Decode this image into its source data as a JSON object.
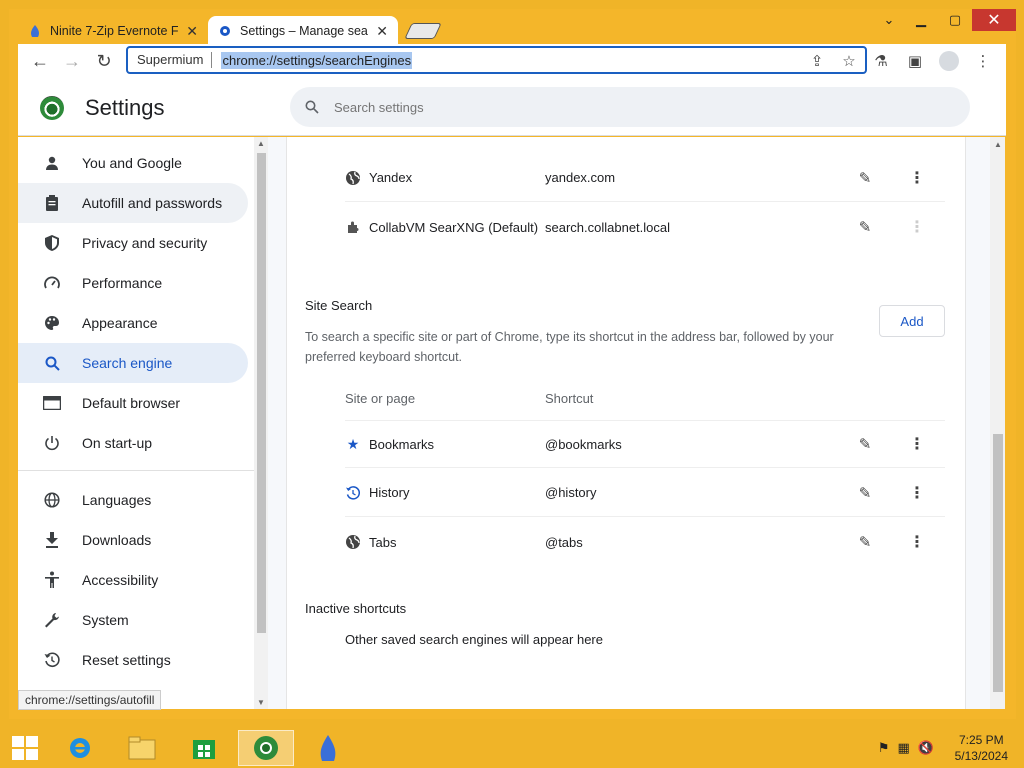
{
  "browser": {
    "tabs": [
      {
        "title": "Ninite 7-Zip Evernote F",
        "active": false
      },
      {
        "title": "Settings – Manage sear",
        "active": true
      }
    ],
    "omnibox": {
      "label": "Supermium",
      "url": "chrome://settings/searchEngines"
    }
  },
  "settings": {
    "title": "Settings",
    "search_placeholder": "Search settings"
  },
  "sidebar": {
    "items": [
      {
        "label": "You and Google",
        "icon": "person-icon"
      },
      {
        "label": "Autofill and passwords",
        "icon": "clipboard-icon",
        "state": "hover"
      },
      {
        "label": "Privacy and security",
        "icon": "shield-icon"
      },
      {
        "label": "Performance",
        "icon": "speedometer-icon"
      },
      {
        "label": "Appearance",
        "icon": "palette-icon"
      },
      {
        "label": "Search engine",
        "icon": "search-icon",
        "state": "selected"
      },
      {
        "label": "Default browser",
        "icon": "browser-icon"
      },
      {
        "label": "On start-up",
        "icon": "power-icon"
      },
      {
        "label": "Languages",
        "icon": "globe-icon"
      },
      {
        "label": "Downloads",
        "icon": "download-icon"
      },
      {
        "label": "Accessibility",
        "icon": "accessibility-icon"
      },
      {
        "label": "System",
        "icon": "wrench-icon"
      },
      {
        "label": "Reset settings",
        "icon": "reset-icon"
      }
    ]
  },
  "status_tip": "chrome://settings/autofill",
  "search_engines": [
    {
      "name": "Yandex",
      "url": "yandex.com",
      "icon": "globe-icon",
      "more_enabled": true
    },
    {
      "name": "CollabVM SearXNG (Default)",
      "url": "search.collabnet.local",
      "icon": "puzzle-icon",
      "more_enabled": false
    }
  ],
  "site_search": {
    "title": "Site Search",
    "description": "To search a specific site or part of Chrome, type its shortcut in the address bar, followed by your preferred keyboard shortcut.",
    "add_label": "Add",
    "columns": [
      "Site or page",
      "Shortcut"
    ],
    "rows": [
      {
        "name": "Bookmarks",
        "shortcut": "@bookmarks",
        "icon": "star-icon"
      },
      {
        "name": "History",
        "shortcut": "@history",
        "icon": "history-icon"
      },
      {
        "name": "Tabs",
        "shortcut": "@tabs",
        "icon": "globe-icon"
      }
    ]
  },
  "inactive": {
    "title": "Inactive shortcuts",
    "message": "Other saved search engines will appear here"
  },
  "taskbar": {
    "time": "7:25 PM",
    "date": "5/13/2024"
  },
  "colors": {
    "accent": "#1a57c6",
    "desktop": "#f0b428"
  }
}
